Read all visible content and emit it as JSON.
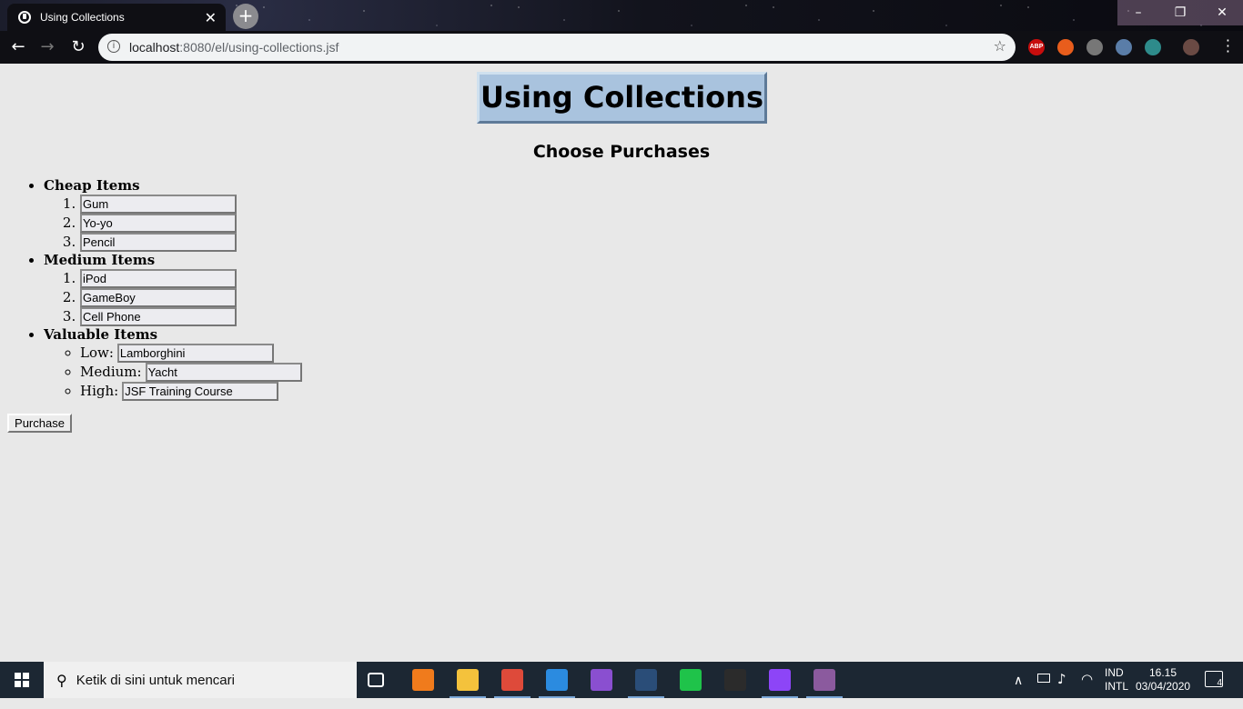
{
  "browser": {
    "tab_title": "Using Collections",
    "tab_close": "✕",
    "new_tab": "+",
    "url_host": "localhost",
    "url_path": ":8080/el/using-collections.jsf",
    "window_buttons": [
      "–",
      "❐",
      "✕"
    ],
    "extensions": [
      {
        "name": "adblock-plus-icon",
        "label": "ABP",
        "color": "#c70d0d"
      },
      {
        "name": "fire-extension-icon",
        "label": "",
        "color": "#e85d1c"
      },
      {
        "name": "extension-icon",
        "label": "",
        "color": "#777777"
      },
      {
        "name": "extension-icon-2",
        "label": "",
        "color": "#5a7da8"
      },
      {
        "name": "reading-glasses-icon",
        "label": "",
        "color": "#2e8b8b"
      }
    ]
  },
  "page": {
    "title": "Using Collections",
    "subtitle": "Choose Purchases",
    "groups": {
      "cheap": {
        "label": "Cheap Items",
        "items": [
          "Gum",
          "Yo-yo",
          "Pencil"
        ]
      },
      "medium": {
        "label": "Medium Items",
        "items": [
          "iPod",
          "GameBoy",
          "Cell Phone"
        ]
      },
      "valuable": {
        "label": "Valuable Items",
        "items": [
          {
            "label": "Low:",
            "value": "Lamborghini"
          },
          {
            "label": "Medium:",
            "value": "Yacht"
          },
          {
            "label": "High:",
            "value": "JSF Training Course"
          }
        ]
      }
    },
    "purchase_label": "Purchase"
  },
  "taskbar": {
    "search_placeholder": "Ketik di sini untuk mencari",
    "language_top": "IND",
    "language_bottom": "INTL",
    "time": "16.15",
    "date": "03/04/2020",
    "notification_count": "4",
    "apps": [
      {
        "name": "task-view-icon",
        "color": "#1c2733"
      },
      {
        "name": "xampp-icon",
        "color": "#f07b1c"
      },
      {
        "name": "file-explorer-icon",
        "color": "#f4c23c"
      },
      {
        "name": "chrome-icon",
        "color": "#de4a3a"
      },
      {
        "name": "vscode-icon",
        "color": "#2b8be0"
      },
      {
        "name": "visual-studio-icon",
        "color": "#8a4fd0"
      },
      {
        "name": "steam-icon",
        "color": "#2a4d78"
      },
      {
        "name": "line-icon",
        "color": "#1fc34a"
      },
      {
        "name": "terminal-icon",
        "color": "#2b2b2b"
      },
      {
        "name": "twitch-icon",
        "color": "#8d45f7"
      },
      {
        "name": "game-icon",
        "color": "#8b5a9e"
      }
    ]
  }
}
